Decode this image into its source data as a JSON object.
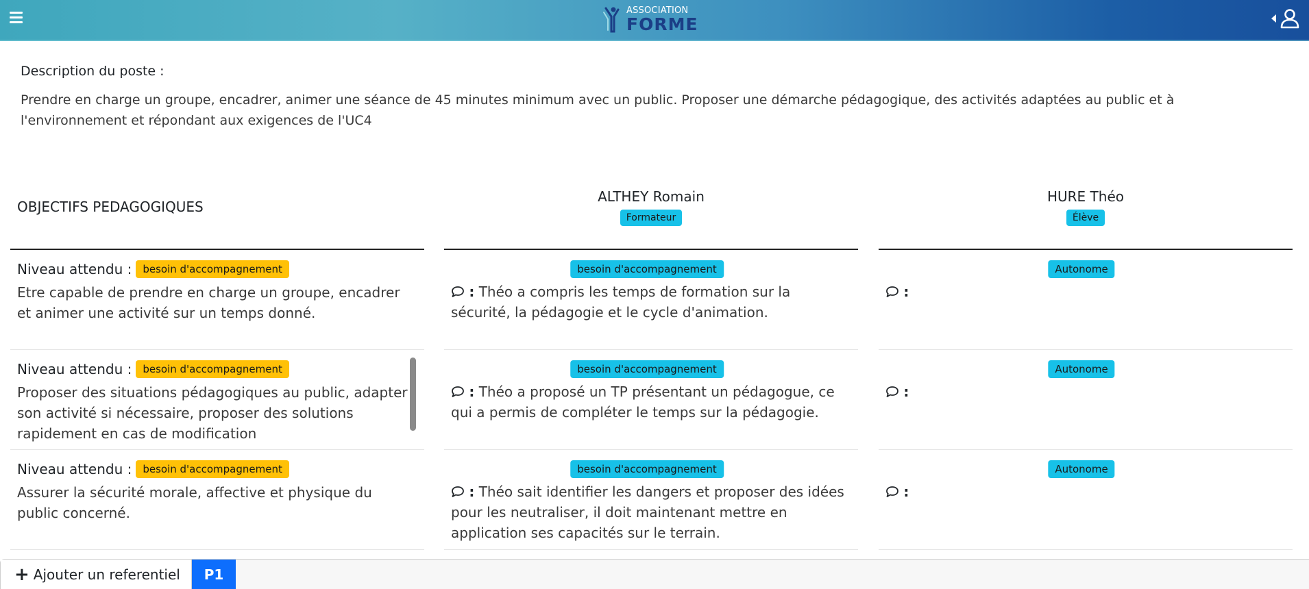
{
  "header": {
    "logo_small": "ASSOCIATION",
    "logo_big": "FORME",
    "menu_icon": "hamburger-icon",
    "user_icon": "user-icon",
    "colors": {
      "gradient_start": "#3fa7bd",
      "gradient_end": "#184f9c"
    }
  },
  "description": {
    "title": "Description du poste :",
    "text": "Prendre en charge un groupe, encadrer, animer une séance de 45 minutes minimum avec un public. Proposer une démarche pédagogique, des activités adaptées au public et à l'environnement et répondant aux exigences de l'UC4"
  },
  "table": {
    "objectives_title": "OBJECTIFS PEDAGOGIQUES",
    "people": [
      {
        "name": "ALTHEY Romain",
        "role": "Formateur"
      },
      {
        "name": "HURE Théo",
        "role": "Élève"
      }
    ],
    "rows": [
      {
        "level_label": "Niveau attendu :",
        "level_badge": "besoin d'accompagnement",
        "objective": "Etre capable de prendre en charge un groupe, encadrer et animer une activité sur un temps donné.",
        "trainer_badge": "besoin d'accompagnement",
        "trainer_comment_prefix": ":",
        "trainer_comment": "Théo a compris les temps de formation sur la sécurité, la pédagogie et le cycle d'animation.",
        "student_badge": "Autonome",
        "student_comment_prefix": ":"
      },
      {
        "level_label": "Niveau attendu :",
        "level_badge": "besoin d'accompagnement",
        "objective": "Proposer des situations pédagogiques au public, adapter son activité si nécessaire, proposer des solutions rapidement en cas de modification",
        "trainer_badge": "besoin d'accompagnement",
        "trainer_comment_prefix": ":",
        "trainer_comment": "Théo a proposé un TP présentant un pédagogue, ce qui a permis de compléter le temps sur la pédagogie.",
        "student_badge": "Autonome",
        "student_comment_prefix": ":"
      },
      {
        "level_label": "Niveau attendu :",
        "level_badge": "besoin d'accompagnement",
        "objective": "Assurer la sécurité morale, affective et physique du public concerné.",
        "trainer_badge": "besoin d'accompagnement",
        "trainer_comment_prefix": ":",
        "trainer_comment": "Théo sait identifier les dangers et proposer des idées pour les neutraliser, il doit maintenant mettre en application ses capacités sur le terrain.",
        "student_badge": "Autonome",
        "student_comment_prefix": ":"
      }
    ]
  },
  "footer": {
    "add_label": "Ajouter un referentiel",
    "add_icon": "plus-icon",
    "page_tab": "P1"
  }
}
